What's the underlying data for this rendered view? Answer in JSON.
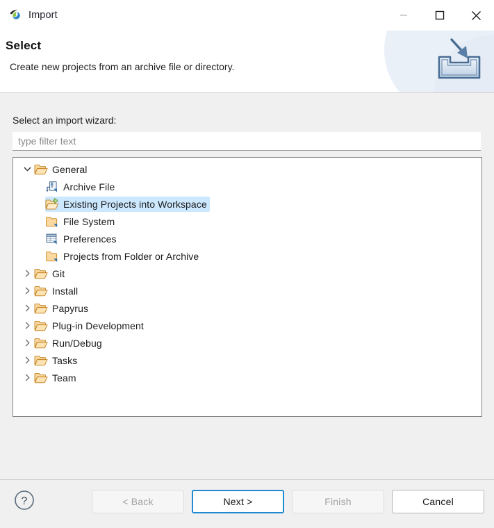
{
  "window": {
    "title": "Import",
    "app_icon": "eclipse-logo-icon",
    "controls": {
      "minimize": "minimize-icon",
      "maximize": "maximize-icon",
      "close": "close-icon"
    }
  },
  "banner": {
    "title": "Select",
    "description": "Create new projects from an archive file or directory.",
    "icon": "import-tray-arrow-icon"
  },
  "main": {
    "field_label": "Select an import wizard:",
    "filter": {
      "value": "",
      "placeholder": "type filter text"
    },
    "tree": [
      {
        "label": "General",
        "level": 0,
        "expanded": true,
        "icon": "open-folder-icon",
        "selected": false
      },
      {
        "label": "Archive File",
        "level": 1,
        "expanded": null,
        "icon": "archive-file-icon",
        "selected": false
      },
      {
        "label": "Existing Projects into Workspace",
        "level": 1,
        "expanded": null,
        "icon": "projects-import-icon",
        "selected": true
      },
      {
        "label": "File System",
        "level": 1,
        "expanded": null,
        "icon": "folder-icon",
        "selected": false
      },
      {
        "label": "Preferences",
        "level": 1,
        "expanded": null,
        "icon": "preferences-grid-icon",
        "selected": false
      },
      {
        "label": "Projects from Folder or Archive",
        "level": 1,
        "expanded": null,
        "icon": "folder-icon",
        "selected": false
      },
      {
        "label": "Git",
        "level": 0,
        "expanded": false,
        "icon": "open-folder-icon",
        "selected": false
      },
      {
        "label": "Install",
        "level": 0,
        "expanded": false,
        "icon": "open-folder-icon",
        "selected": false
      },
      {
        "label": "Papyrus",
        "level": 0,
        "expanded": false,
        "icon": "open-folder-icon",
        "selected": false
      },
      {
        "label": "Plug-in Development",
        "level": 0,
        "expanded": false,
        "icon": "open-folder-icon",
        "selected": false
      },
      {
        "label": "Run/Debug",
        "level": 0,
        "expanded": false,
        "icon": "open-folder-icon",
        "selected": false
      },
      {
        "label": "Tasks",
        "level": 0,
        "expanded": false,
        "icon": "open-folder-icon",
        "selected": false
      },
      {
        "label": "Team",
        "level": 0,
        "expanded": false,
        "icon": "open-folder-icon",
        "selected": false
      }
    ]
  },
  "footer": {
    "help_icon": "help-question-icon",
    "buttons": [
      {
        "label": "< Back",
        "state": "disabled"
      },
      {
        "label": "Next >",
        "state": "default"
      },
      {
        "label": "Finish",
        "state": "disabled"
      },
      {
        "label": "Cancel",
        "state": "enabled"
      }
    ]
  },
  "colors": {
    "selection": "#cce8ff",
    "default_button_border": "#1f8ad2",
    "window_background": "#f0f0f0",
    "folder_icon": "#f0b860"
  }
}
